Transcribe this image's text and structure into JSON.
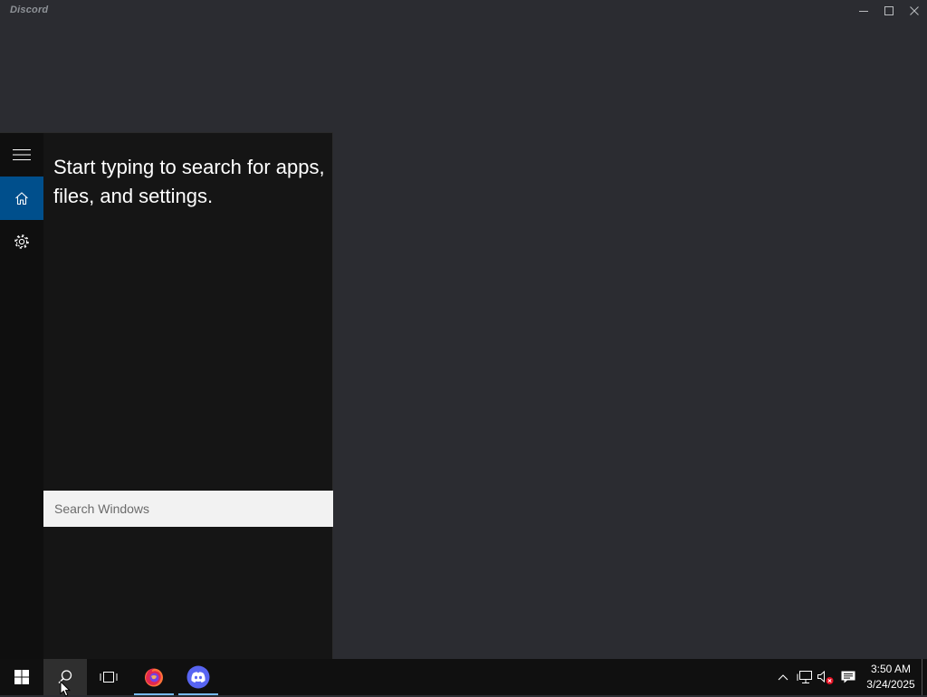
{
  "window": {
    "title": "Discord",
    "controls": [
      "minimize",
      "maximize",
      "close"
    ]
  },
  "search_flyout": {
    "menu_icon": "hamburger-icon",
    "nav": [
      {
        "name": "home",
        "icon": "home-icon",
        "active": true
      },
      {
        "name": "settings",
        "icon": "gear-icon",
        "active": false
      }
    ],
    "prompt": "Start typing to search for apps, files, and settings.",
    "search_placeholder": "Search Windows"
  },
  "taskbar": {
    "buttons": [
      {
        "name": "start",
        "icon": "windows-logo-icon"
      },
      {
        "name": "search",
        "icon": "search-icon",
        "pressed": true
      },
      {
        "name": "task-view",
        "icon": "task-view-icon"
      },
      {
        "name": "firefox",
        "icon": "firefox-icon",
        "running": true
      },
      {
        "name": "discord",
        "icon": "discord-icon",
        "running": true
      }
    ],
    "tray": [
      "chevron-up-icon",
      "network-icon",
      "volume-muted-icon",
      "action-center-icon"
    ],
    "clock": {
      "time": "3:50 AM",
      "date": "3/24/2025"
    }
  },
  "colors": {
    "discord_bg": "#2b2c31",
    "flyout_bg": "#151515",
    "rail_bg": "#0f0f0f",
    "accent": "#004f8c",
    "taskbar_bg": "#101010",
    "running_indicator": "#76b9ed"
  }
}
